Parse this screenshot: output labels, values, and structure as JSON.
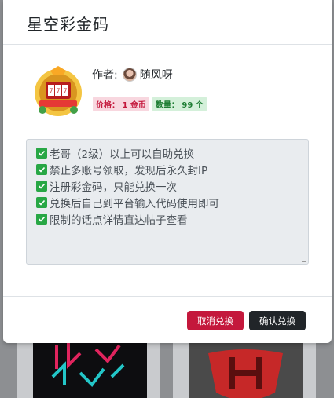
{
  "modal": {
    "title": "星空彩金码",
    "author_label": "作者:",
    "author_name": "随风呀",
    "price_badge": "价格： 1 金币",
    "count_badge": "数量： 99 个",
    "rules": [
      "老哥（2级）以上可以自助兑换",
      "禁止多账号领取，发现后永久封IP",
      "注册彩金码，只能兑换一次",
      "兑换后自己到平台输入代码使用即可",
      "限制的话点详情直达帖子查看"
    ],
    "cancel_label": "取消兑换",
    "confirm_label": "确认兑换"
  },
  "colors": {
    "danger": "#c4183c",
    "dark": "#212529",
    "check": "#28a745"
  },
  "icons": [
    "check-icon",
    "slot-machine-logo",
    "avatar"
  ]
}
